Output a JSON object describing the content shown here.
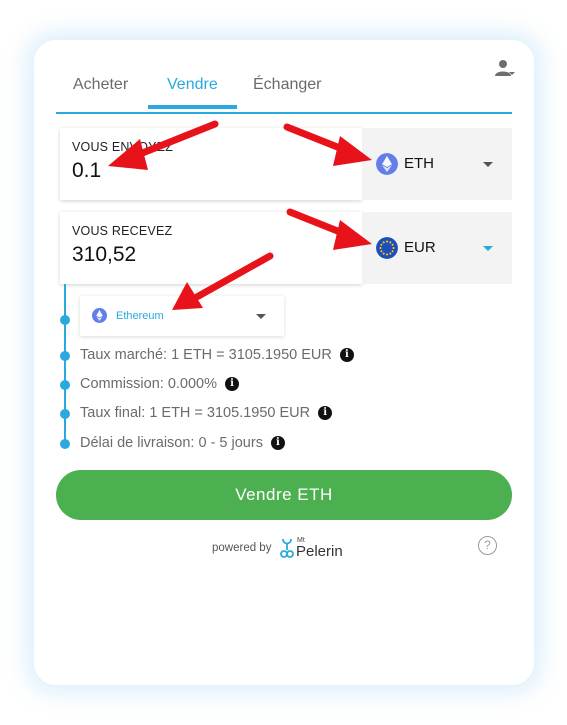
{
  "tabs": [
    {
      "label": "Acheter",
      "active": false
    },
    {
      "label": "Vendre",
      "active": true
    },
    {
      "label": "Échanger",
      "active": false
    }
  ],
  "send": {
    "label": "VOUS ENVOYEZ",
    "value": "0.1",
    "currency": "ETH",
    "currency_icon": "ethereum-icon"
  },
  "receive": {
    "label": "VOUS RECEVEZ",
    "value": "310,52",
    "currency": "EUR",
    "currency_icon": "euro-flag-icon"
  },
  "network": {
    "label": "Ethereum",
    "icon": "ethereum-icon"
  },
  "info": [
    "Taux marché: 1 ETH = 3105.1950 EUR",
    "Commission: 0.000%",
    "Taux final: 1 ETH = 3105.1950 EUR",
    "Délai de livraison: 0 - 5 jours"
  ],
  "cta": {
    "label": "Vendre ETH"
  },
  "footer": {
    "powered_by": "powered by",
    "brand_small": "Mt",
    "brand_name": "Pelerin"
  },
  "colors": {
    "accent": "#29a9e0",
    "cta": "#4caf50",
    "annotation_arrow": "#e8131a",
    "ethereum": "#627eea",
    "euro": "#1f4dbb"
  }
}
